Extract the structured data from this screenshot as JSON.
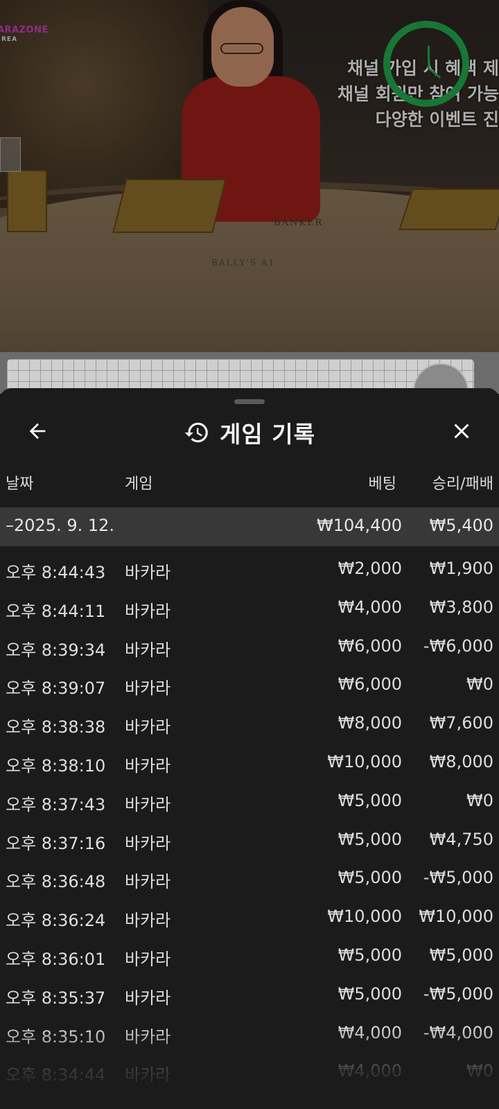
{
  "video": {
    "brand": "ARAZONE",
    "brand_sub": "REA",
    "promo_lines": [
      "채널 가입 시 혜택 제",
      "채널 회원만 참여 가능",
      "다양한 이벤트 진"
    ],
    "table_label": "BANKER",
    "table_logo": "BALLY'S A1"
  },
  "sheet": {
    "title": "게임 기록",
    "columns": {
      "date": "날짜",
      "game": "게임",
      "bet": "베팅",
      "result": "승리/패배"
    },
    "summary": {
      "date": "–2025. 9. 12.",
      "bet": "₩104,400",
      "result": "₩5,400"
    },
    "rows": [
      {
        "time": "오후 8:44:43",
        "game": "바카라",
        "bet": "₩2,000",
        "result": "₩1,900"
      },
      {
        "time": "오후 8:44:11",
        "game": "바카라",
        "bet": "₩4,000",
        "result": "₩3,800"
      },
      {
        "time": "오후 8:39:34",
        "game": "바카라",
        "bet": "₩6,000",
        "result": "-₩6,000"
      },
      {
        "time": "오후 8:39:07",
        "game": "바카라",
        "bet": "₩6,000",
        "result": "₩0"
      },
      {
        "time": "오후 8:38:38",
        "game": "바카라",
        "bet": "₩8,000",
        "result": "₩7,600"
      },
      {
        "time": "오후 8:38:10",
        "game": "바카라",
        "bet": "₩10,000",
        "result": "₩8,000"
      },
      {
        "time": "오후 8:37:43",
        "game": "바카라",
        "bet": "₩5,000",
        "result": "₩0"
      },
      {
        "time": "오후 8:37:16",
        "game": "바카라",
        "bet": "₩5,000",
        "result": "₩4,750"
      },
      {
        "time": "오후 8:36:48",
        "game": "바카라",
        "bet": "₩5,000",
        "result": "-₩5,000"
      },
      {
        "time": "오후 8:36:24",
        "game": "바카라",
        "bet": "₩10,000",
        "result": "₩10,000"
      },
      {
        "time": "오후 8:36:01",
        "game": "바카라",
        "bet": "₩5,000",
        "result": "₩5,000"
      },
      {
        "time": "오후 8:35:37",
        "game": "바카라",
        "bet": "₩5,000",
        "result": "-₩5,000"
      },
      {
        "time": "오후 8:35:10",
        "game": "바카라",
        "bet": "₩4,000",
        "result": "-₩4,000"
      },
      {
        "time": "오후 8:34:44",
        "game": "바카라",
        "bet": "₩4,000",
        "result": "₩0"
      }
    ]
  },
  "icons": {
    "back": "arrow-left-icon",
    "history": "history-icon",
    "close": "close-icon"
  },
  "colors": {
    "sheet_bg": "#1b1b1b",
    "summary_bg": "#383838",
    "timer": "#22a64a"
  }
}
